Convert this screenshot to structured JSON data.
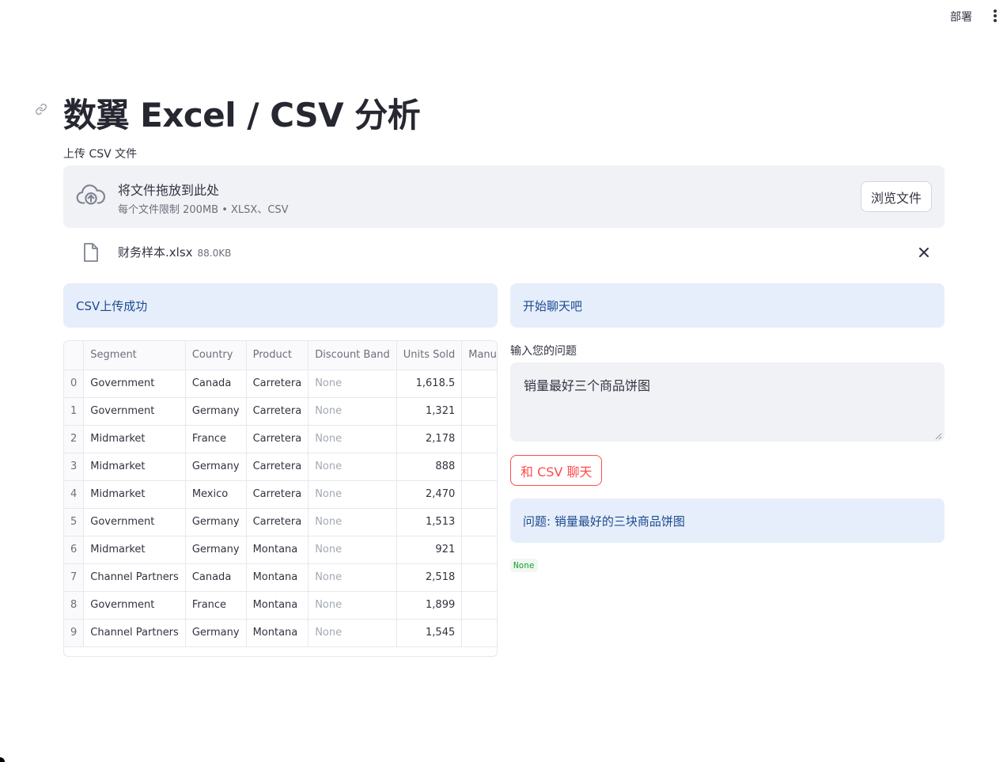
{
  "header": {
    "deploy_label": "部署",
    "menu_icon": "kebab-menu-icon"
  },
  "page": {
    "title": "数翼 Excel / CSV 分析",
    "anchor_icon": "link-icon"
  },
  "uploader": {
    "label": "上传 CSV 文件",
    "drop_text": "将文件拖放到此处",
    "limit_text": "每个文件限制 200MB • XLSX、CSV",
    "browse_label": "浏览文件",
    "icon": "cloud-upload-icon"
  },
  "uploaded_file": {
    "name": "财务样本.xlsx",
    "size": "88.0KB",
    "icon": "file-icon",
    "remove_icon": "close-icon"
  },
  "left": {
    "success_message": "CSV上传成功"
  },
  "dataframe": {
    "columns": [
      "Segment",
      "Country",
      "Product",
      "Discount Band",
      "Units Sold",
      "Manufac"
    ],
    "rows": [
      {
        "index": "0",
        "segment": "Government",
        "country": "Canada",
        "product": "Carretera",
        "discount": "None",
        "units": "1,618.5"
      },
      {
        "index": "1",
        "segment": "Government",
        "country": "Germany",
        "product": "Carretera",
        "discount": "None",
        "units": "1,321"
      },
      {
        "index": "2",
        "segment": "Midmarket",
        "country": "France",
        "product": "Carretera",
        "discount": "None",
        "units": "2,178"
      },
      {
        "index": "3",
        "segment": "Midmarket",
        "country": "Germany",
        "product": "Carretera",
        "discount": "None",
        "units": "888"
      },
      {
        "index": "4",
        "segment": "Midmarket",
        "country": "Mexico",
        "product": "Carretera",
        "discount": "None",
        "units": "2,470"
      },
      {
        "index": "5",
        "segment": "Government",
        "country": "Germany",
        "product": "Carretera",
        "discount": "None",
        "units": "1,513"
      },
      {
        "index": "6",
        "segment": "Midmarket",
        "country": "Germany",
        "product": "Montana",
        "discount": "None",
        "units": "921"
      },
      {
        "index": "7",
        "segment": "Channel Partners",
        "country": "Canada",
        "product": "Montana",
        "discount": "None",
        "units": "2,518"
      },
      {
        "index": "8",
        "segment": "Government",
        "country": "France",
        "product": "Montana",
        "discount": "None",
        "units": "1,899"
      },
      {
        "index": "9",
        "segment": "Channel Partners",
        "country": "Germany",
        "product": "Montana",
        "discount": "None",
        "units": "1,545"
      }
    ]
  },
  "chat": {
    "header": "开始聊天吧",
    "input_label": "输入您的问题",
    "input_value": "销量最好三个商品饼图",
    "button_label": "和 CSV 聊天",
    "question_text": "问题: 销量最好的三块商品饼图",
    "result": "None"
  },
  "colors": {
    "accent": "#ff4b4b",
    "info_bg": "#e6eefb",
    "info_text": "#1b4a8e",
    "input_bg": "#f0f2f6",
    "result_green": "#1a9e3a"
  }
}
